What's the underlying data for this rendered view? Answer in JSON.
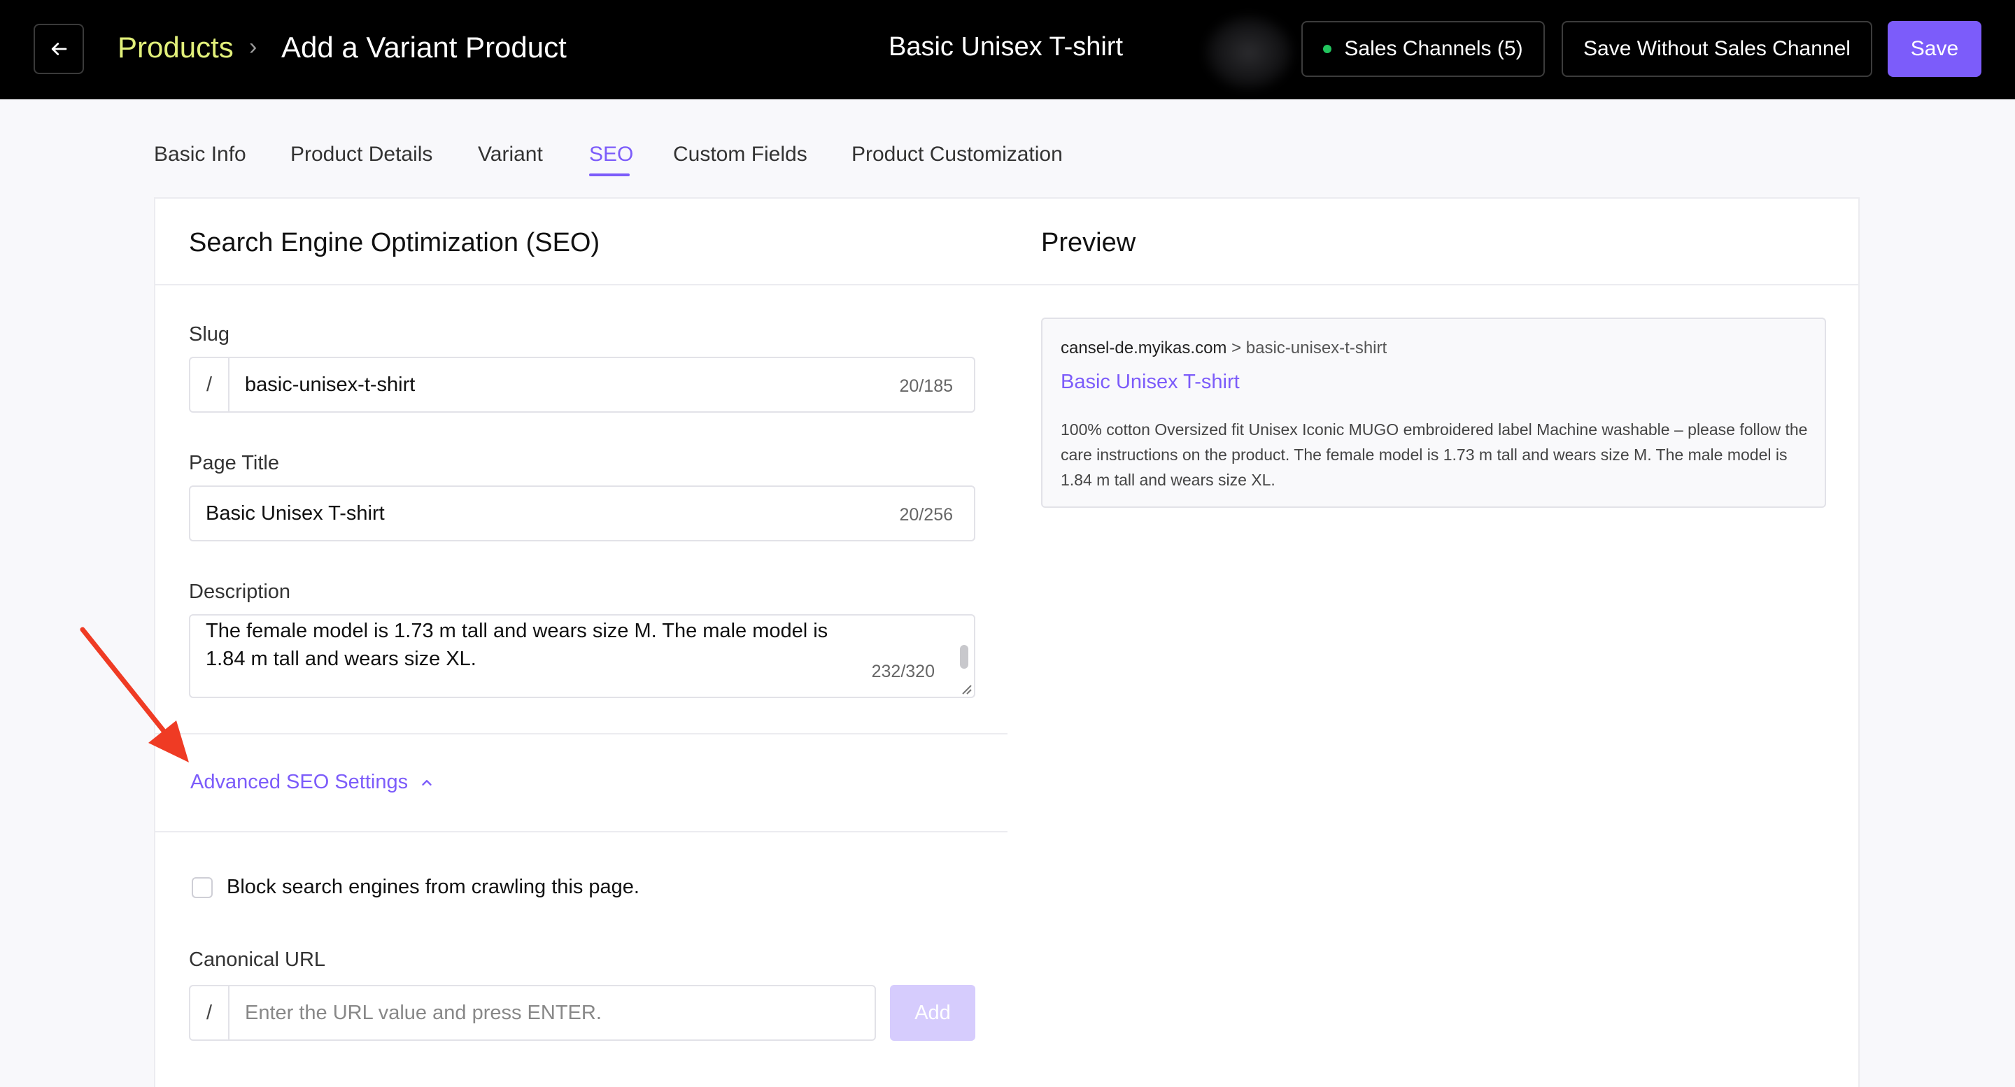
{
  "topbar": {
    "breadcrumb_parent": "Products",
    "breadcrumb_separator": "›",
    "breadcrumb_current": "Add a Variant Product",
    "product_name": "Basic Unisex T-shirt",
    "sales_channels_label": "Sales Channels (5)",
    "save_without_label": "Save Without Sales Channel",
    "save_label": "Save",
    "accent_color": "#7c5cfa",
    "breadcrumb_color": "#e2f07a",
    "status_dot_color": "#22c55e"
  },
  "tabs": [
    {
      "label": "Basic Info",
      "active": false
    },
    {
      "label": "Product Details",
      "active": false
    },
    {
      "label": "Variant",
      "active": false
    },
    {
      "label": "SEO",
      "active": true
    },
    {
      "label": "Custom Fields",
      "active": false
    },
    {
      "label": "Product Customization",
      "active": false
    }
  ],
  "seo": {
    "title": "Search Engine Optimization (SEO)",
    "slug_label": "Slug",
    "slug_prefix": "/",
    "slug_value": "basic-unisex-t-shirt",
    "slug_counter": "20/185",
    "page_title_label": "Page Title",
    "page_title_value": "Basic Unisex T-shirt",
    "page_title_counter": "20/256",
    "description_label": "Description",
    "description_value": "Machine washable – please follow the care instructions on the product. The female model is 1.73 m tall and wears size M. The male model is 1.84 m tall and wears size XL.",
    "description_counter": "232/320",
    "advanced_label": "Advanced SEO Settings",
    "block_crawl_label": "Block search engines from crawling this page.",
    "block_crawl_checked": false,
    "canonical_label": "Canonical URL",
    "canonical_prefix": "/",
    "canonical_placeholder": "Enter the URL value and press ENTER.",
    "add_label": "Add"
  },
  "preview": {
    "title": "Preview",
    "domain": "cansel-de.myikas.com",
    "path": " > basic-unisex-t-shirt",
    "page_title": "Basic Unisex T-shirt",
    "description": "100% cotton Oversized fit Unisex Iconic MUGO embroidered label Machine washable – please follow the care instructions on the product. The female model is 1.73 m tall and wears size M. The male model is 1.84 m tall and wears size XL."
  }
}
